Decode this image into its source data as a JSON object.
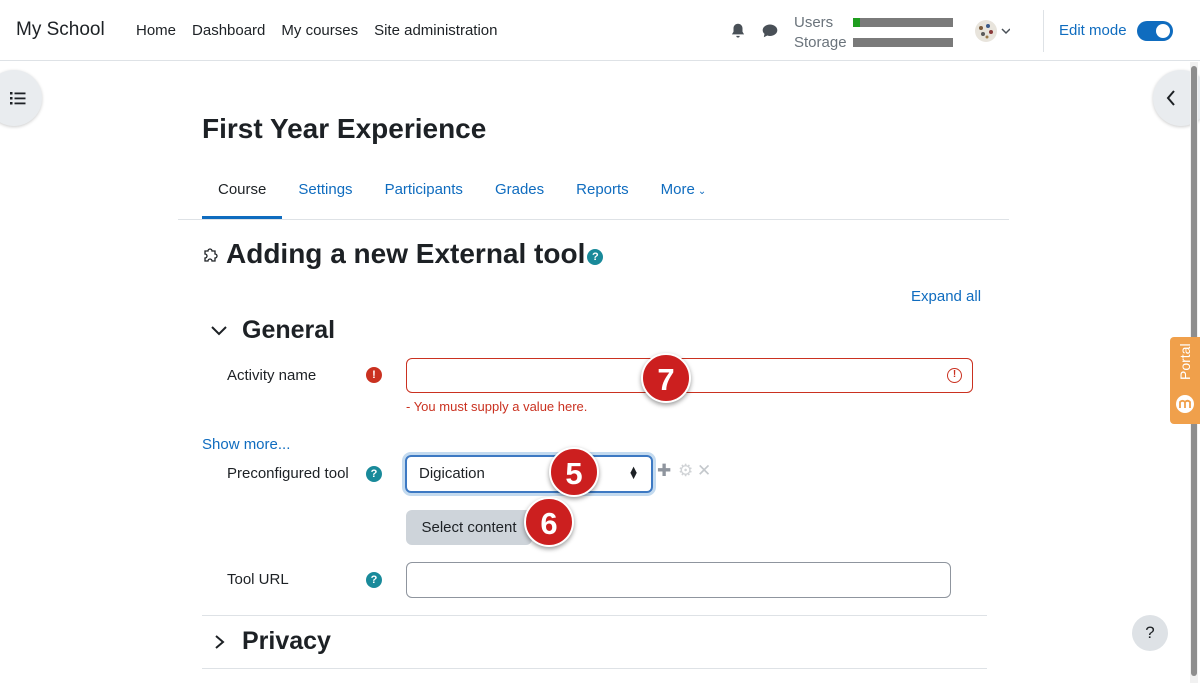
{
  "navbar": {
    "brand": "My School",
    "links": [
      "Home",
      "Dashboard",
      "My courses",
      "Site administration"
    ],
    "quota_users_label": "Users",
    "quota_storage_label": "Storage",
    "users_fill": 0.07,
    "storage_fill": 0.0,
    "edit_mode_label": "Edit mode",
    "edit_mode_on": true
  },
  "course": {
    "title": "First Year Experience",
    "tabs": [
      "Course",
      "Settings",
      "Participants",
      "Grades",
      "Reports",
      "More"
    ]
  },
  "form": {
    "heading": "Adding a new External tool",
    "expand_all": "Expand all",
    "general_section": "General",
    "activity_name_label": "Activity name",
    "activity_name_value": "",
    "activity_name_error": "- You must supply a value here.",
    "show_more": "Show more...",
    "preconfigured_tool_label": "Preconfigured tool",
    "preconfigured_tool_value": "Digication",
    "select_content_button": "Select content",
    "tool_url_label": "Tool URL",
    "tool_url_value": "",
    "privacy_section": "Privacy"
  },
  "annotations": [
    "5",
    "6",
    "7"
  ],
  "side": {
    "portal_label": "Portal",
    "help_label": "?"
  },
  "colors": {
    "brand_blue": "#0f6cbf",
    "error_red": "#ca3120",
    "badge_red": "#cc1f1f",
    "help_teal": "#198a9a",
    "portal_orange": "#f0a04b"
  }
}
